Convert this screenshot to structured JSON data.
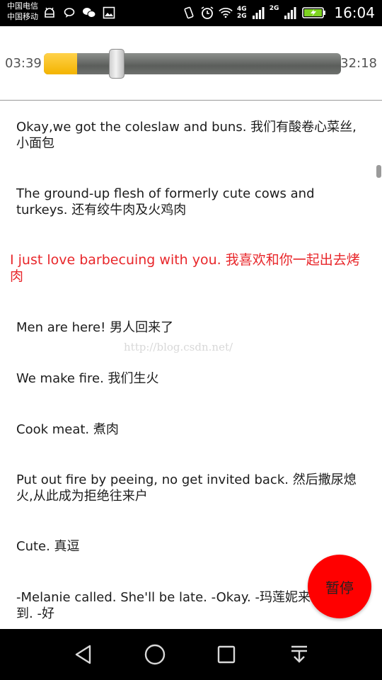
{
  "status_bar": {
    "carrier_1": "中国电信",
    "carrier_2": "中国移动",
    "net_1": "4G",
    "net_1b": "2G",
    "net_2": "2G",
    "time": "16:04"
  },
  "player": {
    "current_time": "03:39",
    "total_time": "32:18",
    "progress": 0.113
  },
  "lyrics": [
    "Okay,we got the coleslaw and buns. 我们有酸卷心菜丝,小面包",
    "The ground-up flesh of formerly cute cows and turkeys. 还有绞牛肉及火鸡肉",
    "I just love barbecuing with you. 我喜欢和你一起出去烤肉",
    "Men are here! 男人回来了",
    "We make fire. 我们生火",
    "Cook meat. 煮肉",
    "Put out fire by peeing, no get invited back. 然后撒尿熄火,从此成为拒绝往来户",
    "Cute. 真逗",
    "-Melanie called. She'll be late. -Okay. -玛莲妮来电 会迟到. -好"
  ],
  "current_lyric_index": 2,
  "watermark": "http://blog.csdn.net/",
  "pause_button_label": "暂停",
  "colors": {
    "accent_red": "#ff0000",
    "current_lyric": "#e8262a",
    "progress_fill": "#f3b400"
  },
  "icons": {
    "nav_back": "back-triangle-icon",
    "nav_home": "home-circle-icon",
    "nav_recent": "recent-square-icon",
    "nav_notification": "notification-pulldown-icon"
  }
}
